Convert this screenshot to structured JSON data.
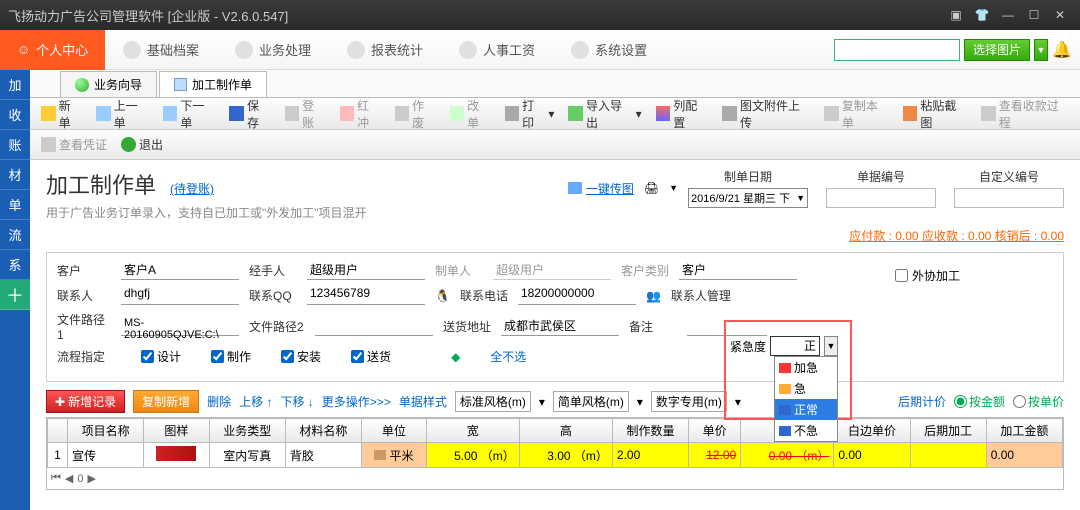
{
  "titlebar": {
    "title": "飞扬动力广告公司管理软件 [企业版 - V2.6.0.547]"
  },
  "topmenu": {
    "usercenter": "个人中心",
    "items": [
      "基础档案",
      "业务处理",
      "报表统计",
      "人事工资",
      "系统设置"
    ],
    "select_pic": "选择图片"
  },
  "sidebar": {
    "items": [
      "加",
      "收",
      "账",
      "材",
      "单",
      "流",
      "系"
    ]
  },
  "doctabs": {
    "tab1": "业务向导",
    "tab2": "加工制作单"
  },
  "toolbar": {
    "new": "新单",
    "prev": "上一单",
    "next": "下一单",
    "save": "保存",
    "post": "登账",
    "red": "红冲",
    "void": "作废",
    "edit": "改单",
    "print": "打印",
    "io": "导入导出",
    "cols": "列配置",
    "attach": "图文附件上传",
    "copy": "复制本单",
    "paste": "粘贴截图",
    "viewpay": "查看收款过程"
  },
  "toolbar2": {
    "voucher": "查看凭证",
    "exit": "退出"
  },
  "dochead": {
    "title": "加工制作单",
    "status": "(待登账)",
    "sub": "用于广告业务订单录入，支持自已加工或\"外发加工\"项目混开",
    "onekeytransfer": "一键传图"
  },
  "meta": {
    "date_label": "制单日期",
    "date": "2016/9/21 星期三 下",
    "docno_label": "单据编号",
    "custno_label": "自定义编号",
    "payinfo": "应付款 : 0.00 应收款 : 0.00  核销后 : 0.00"
  },
  "form": {
    "customer_l": "客户",
    "customer": "客户A",
    "handler_l": "经手人",
    "handler": "超级用户",
    "creator_l": "制单人",
    "creator": "超级用户",
    "custtype_l": "客户类别",
    "custtype": "客户",
    "contact_l": "联系人",
    "contact": "dhgfj",
    "qq_l": "联系QQ",
    "qq": "123456789",
    "phone_l": "联系电话",
    "phone": "18200000000",
    "contact_mgr": "联系人管理",
    "path1_l": "文件路径1",
    "path1": "MS-20160905QJVE:C:\\",
    "path2_l": "文件路径2",
    "addr_l": "送货地址",
    "addr": "成都市武侯区",
    "remark_l": "备注",
    "process_l": "流程指定",
    "design": "设计",
    "make": "制作",
    "install": "安装",
    "deliver": "送货",
    "all_not": "全不选",
    "urgency_l": "紧急度",
    "urgency": "正",
    "urgency_opts": [
      "加急",
      "急",
      "正常",
      "不急"
    ],
    "outsource": "外协加工"
  },
  "gridtools": {
    "add": "新增记录",
    "copynew": "复制新增",
    "del": "删除",
    "up": "上移 ↑",
    "down": "下移 ↓",
    "more": "更多操作>>>",
    "rowstyle": "单据样式",
    "std": "标准风格(m)",
    "simple": "简单风格(m)",
    "num": "数字专用(m)",
    "latecalc": "后期计价",
    "byamt": "按金额",
    "byprice": "按单价"
  },
  "table": {
    "headers": [
      "",
      "项目名称",
      "图样",
      "业务类型",
      "材料名称",
      "单位",
      "宽",
      "高",
      "制作数量",
      "单价",
      "",
      "白边单价",
      "后期加工",
      "加工金额"
    ],
    "row": {
      "idx": "1",
      "name": "宣传",
      "biztype": "室内写真",
      "material": "背胶",
      "unit": "平米",
      "w": "5.00 （m）",
      "h": "3.00 （m）",
      "qty": "2.00",
      "price": "12.00",
      "x": "0.00 （m）",
      "blank": "0.00",
      "late": "",
      "amt": "0.00"
    }
  },
  "pager": {
    "page": "0"
  }
}
